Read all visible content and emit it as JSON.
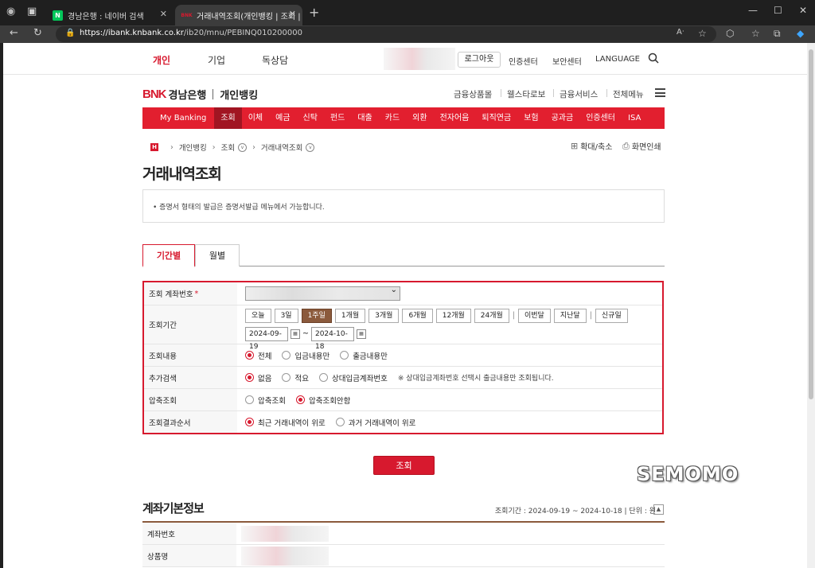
{
  "browser": {
    "tabs": [
      {
        "title": "경남은행 : 네이버 검색",
        "favicon": "N",
        "favicon_color": "#03c75a",
        "active": false
      },
      {
        "title": "거래내역조회(개인뱅킹 | 조회 | 거",
        "favicon": "BNK",
        "favicon_color": "#d7192e",
        "active": true
      }
    ],
    "url_host": "https://ibank.knbank.co.kr",
    "url_path": "/ib20/mnu/PEBINQ010200000"
  },
  "gnb": {
    "items": [
      "개인",
      "기업",
      "독상담"
    ],
    "active": "개인",
    "login": "로그아웃",
    "utils": [
      "인증센터",
      "보안센터",
      "LANGUAGE"
    ]
  },
  "brand": {
    "logo": "BNK",
    "bank_name": "경남은행",
    "service": "개인뱅킹"
  },
  "top_menu": [
    "금융상품몰",
    "웰스타로보",
    "금융서비스",
    "전체메뉴"
  ],
  "main_nav": [
    "My Banking",
    "조회",
    "이체",
    "예금",
    "신탁",
    "펀드",
    "대출",
    "카드",
    "외환",
    "전자어음",
    "퇴직연금",
    "보험",
    "공과금",
    "인증센터",
    "ISA"
  ],
  "main_nav_active": "조회",
  "breadcrumb": {
    "home": "H",
    "items": [
      "개인뱅킹",
      "조회",
      "거래내역조회"
    ]
  },
  "page_tools": {
    "zoom": "확대/축소",
    "print": "화면인쇄"
  },
  "page_title": "거래내역조회",
  "notice": "• 증명서 형태의 발급은 증명서발급 메뉴에서 가능합니다.",
  "tabs": [
    "기간별",
    "월별"
  ],
  "form": {
    "account": {
      "label": "조회 계좌번호",
      "required": "*"
    },
    "period": {
      "label": "조회기간",
      "buttons": [
        "오늘",
        "3일",
        "1주일",
        "1개월",
        "3개월",
        "6개월",
        "12개월",
        "24개월"
      ],
      "active": "1주일",
      "extra_buttons": [
        "이번달",
        "지난달",
        "신규일"
      ],
      "date_from": "2024-09-19",
      "tilde": "~",
      "date_to": "2024-10-18"
    },
    "content": {
      "label": "조회내용",
      "options": [
        "전체",
        "입금내용만",
        "출금내용만"
      ],
      "selected": 0
    },
    "extra": {
      "label": "추가검색",
      "options": [
        "없음",
        "적요",
        "상대입금계좌번호"
      ],
      "selected": 0,
      "hint": "※ 상대입금계좌번호 선택시 출금내용만 조회됩니다."
    },
    "compress": {
      "label": "압축조회",
      "options": [
        "압축조회",
        "압축조회안함"
      ],
      "selected": 1
    },
    "order": {
      "label": "조회결과순서",
      "options": [
        "최근 거래내역이 위로",
        "과거 거래내역이 위로"
      ],
      "selected": 0
    }
  },
  "submit": "조회",
  "watermark": "SEMOMO",
  "account_info": {
    "title": "계좌기본정보",
    "meta": "조회기간 : 2024-09-19 ~ 2024-10-18 | 단위 : 원",
    "rows": [
      "계좌번호",
      "상품명"
    ]
  },
  "colors": {
    "brand_red": "#d7192e",
    "nav_red": "#e21f2f",
    "active_brown": "#8b5a3c"
  }
}
